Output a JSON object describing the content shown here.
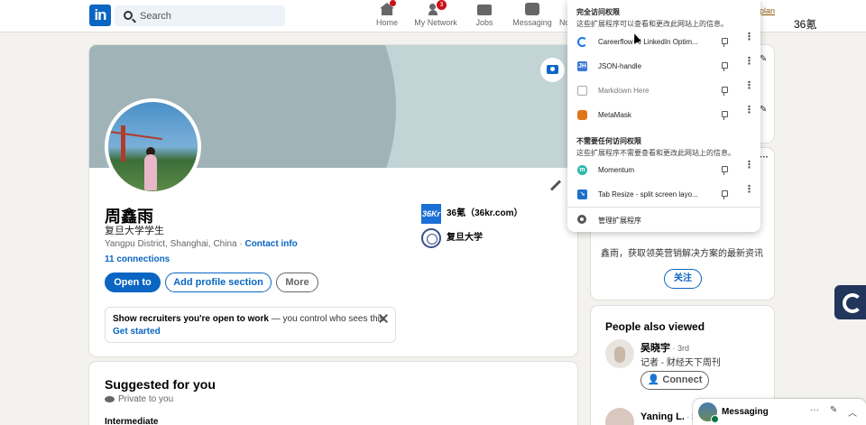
{
  "nav": {
    "logo": "in",
    "search_placeholder": "Search",
    "items": [
      {
        "label": "Home",
        "badge": ""
      },
      {
        "label": "My Network",
        "badge": "3"
      },
      {
        "label": "Jobs",
        "badge": ""
      },
      {
        "label": "Messaging",
        "badge": ""
      }
    ],
    "truncated_item": "No",
    "plan_link": "plan",
    "right_text": "36氪"
  },
  "profile": {
    "name": "周鑫雨",
    "headline": "复旦大学学生",
    "location": "Yangpu District, Shanghai, China",
    "location_sep": " · ",
    "contact_info": "Contact info",
    "connections": "11 connections",
    "buttons": {
      "open_to": "Open to",
      "add_section": "Add profile section",
      "more": "More"
    },
    "experience": [
      {
        "logo_text": "36Kr",
        "name": "36氪（36kr.com）"
      },
      {
        "logo_text": "",
        "name": "复旦大学"
      }
    ],
    "recruiter": {
      "bold": "Show recruiters you're open to work",
      "rest": " — you control who sees this.",
      "link": "Get started"
    }
  },
  "suggested": {
    "title": "Suggested for you",
    "private": "Private to you",
    "sub": "Intermediate"
  },
  "right": {
    "promo_text": "鑫雨，获取领英营销解决方案的最新资讯",
    "follow_label": "关注",
    "people_title": "People also viewed",
    "people": [
      {
        "name": "吴晓宇",
        "degree": " · 3rd",
        "role": "记者 - 财经天下周刊",
        "action": "Connect"
      },
      {
        "name": "Yaning L.",
        "degree": " · 3"
      }
    ]
  },
  "messaging": {
    "title": "Messaging",
    "more": "···",
    "compose": "✎",
    "collapse": "︿"
  },
  "extensions_popup": {
    "full_access_title": "完全访问权限",
    "full_access_desc": "这些扩展程序可以查看和更改此网站上的信息。",
    "full_access": [
      {
        "name": "Careerflow AI LinkedIn Optim...",
        "icon_text": "C",
        "dim": false
      },
      {
        "name": "JSON-handle",
        "icon_text": "JH",
        "dim": false
      },
      {
        "name": "Markdown Here",
        "icon_text": "",
        "dim": true
      },
      {
        "name": "MetaMask",
        "icon_text": "",
        "dim": false
      }
    ],
    "no_access_title": "不需要任何访问权限",
    "no_access_desc": "这些扩展程序不需要查看和更改此网站上的信息。",
    "no_access": [
      {
        "name": "Momentum",
        "icon_text": "m"
      },
      {
        "name": "Tab Resize - split screen layo...",
        "icon_text": "↘"
      }
    ],
    "manage_label": "管理扩展程序",
    "kebab": "⋮"
  }
}
